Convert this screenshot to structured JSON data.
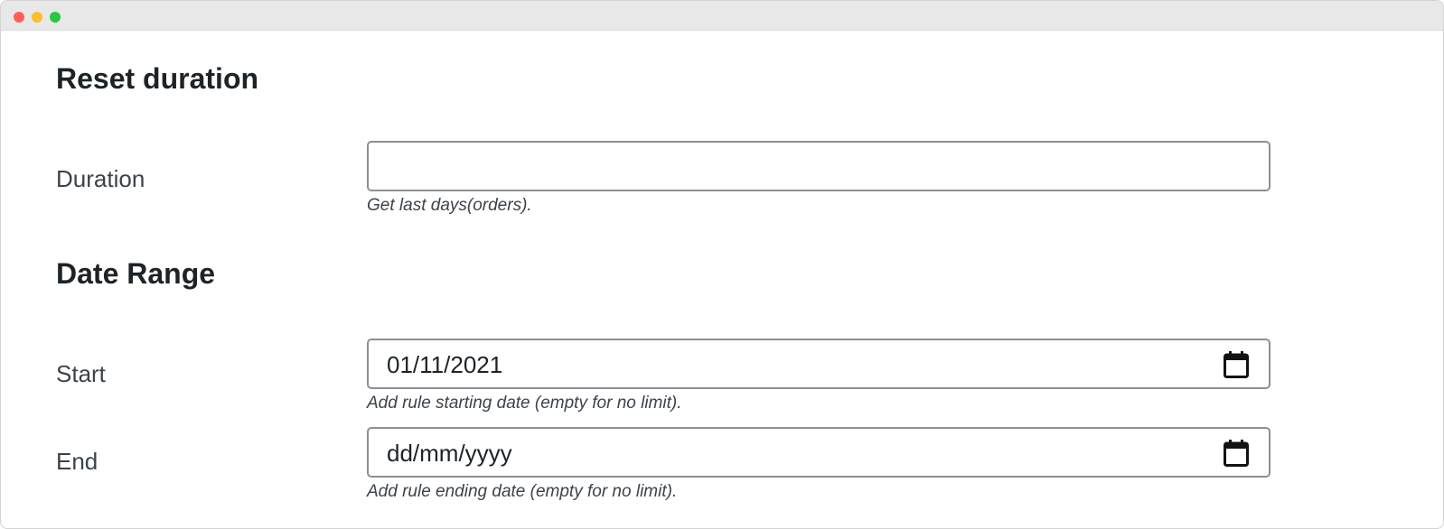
{
  "sections": {
    "reset": {
      "title": "Reset duration"
    },
    "range": {
      "title": "Date Range"
    }
  },
  "fields": {
    "duration": {
      "label": "Duration",
      "value": "",
      "help": "Get last days(orders)."
    },
    "start": {
      "label": "Start",
      "value": "01/11/2021",
      "help": "Add rule starting date (empty for no limit).",
      "icon": "calendar-icon"
    },
    "end": {
      "label": "End",
      "value": "dd/mm/yyyy",
      "help": "Add rule ending date (empty for no limit).",
      "icon": "calendar-icon"
    }
  },
  "colors": {
    "titlebar": "#e8e8e8",
    "close": "#fe5f57",
    "minimize": "#febc2e",
    "maximize": "#28c840",
    "input_border": "#8c8f94"
  }
}
